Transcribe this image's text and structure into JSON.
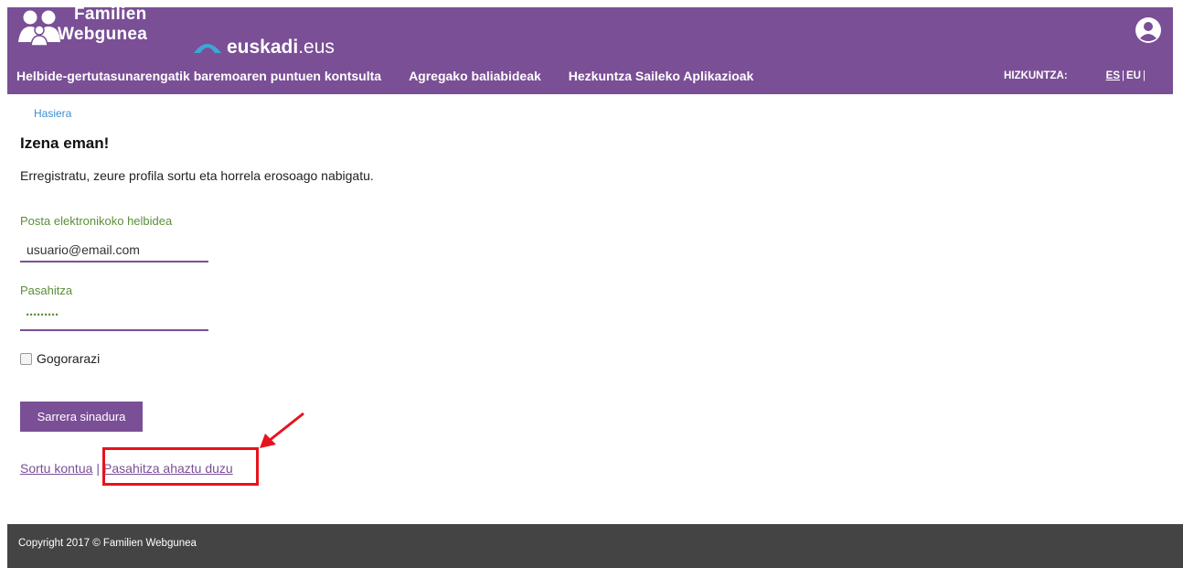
{
  "header": {
    "brand_line1": "Familien",
    "brand_line2": "Webgunea",
    "partner_bold": "euskadi",
    "partner_suffix": ".eus",
    "colors": {
      "background": "#7a4f96",
      "text": "#ffffff"
    },
    "icons": {
      "brand": "family-icon",
      "partner": "euskadi-logo-icon",
      "user": "user-account-icon"
    }
  },
  "nav": {
    "items": [
      {
        "label": "Helbide-gertutasunarengatik baremoaren puntuen kontsulta"
      },
      {
        "label": "Agregako baliabideak"
      },
      {
        "label": "Hezkuntza Saileko Aplikazioak"
      }
    ]
  },
  "language": {
    "label": "HIZKUNTZA:",
    "options": [
      "ES",
      "EU"
    ],
    "selected": "ES"
  },
  "breadcrumb": {
    "home": "Hasiera"
  },
  "page": {
    "title": "Izena eman!",
    "subtitle": "Erregistratu, zeure profila sortu eta horrela erosoago nabigatu."
  },
  "form": {
    "email_label": "Posta elektronikoko helbidea",
    "email_value": "usuario@email.com",
    "password_label": "Pasahitza",
    "password_value": "·········",
    "remember_label": "Gogorarazi",
    "remember_checked": false,
    "submit_label": "Sarrera sinadura"
  },
  "links": {
    "create_account": "Sortu kontua",
    "separator": "|",
    "forgot_password": "Pasahitza ahaztu duzu"
  },
  "annotation": {
    "color": "#e8121c"
  },
  "footer": {
    "text": "Copyright 2017 © Familien Webgunea",
    "background": "#444444"
  }
}
